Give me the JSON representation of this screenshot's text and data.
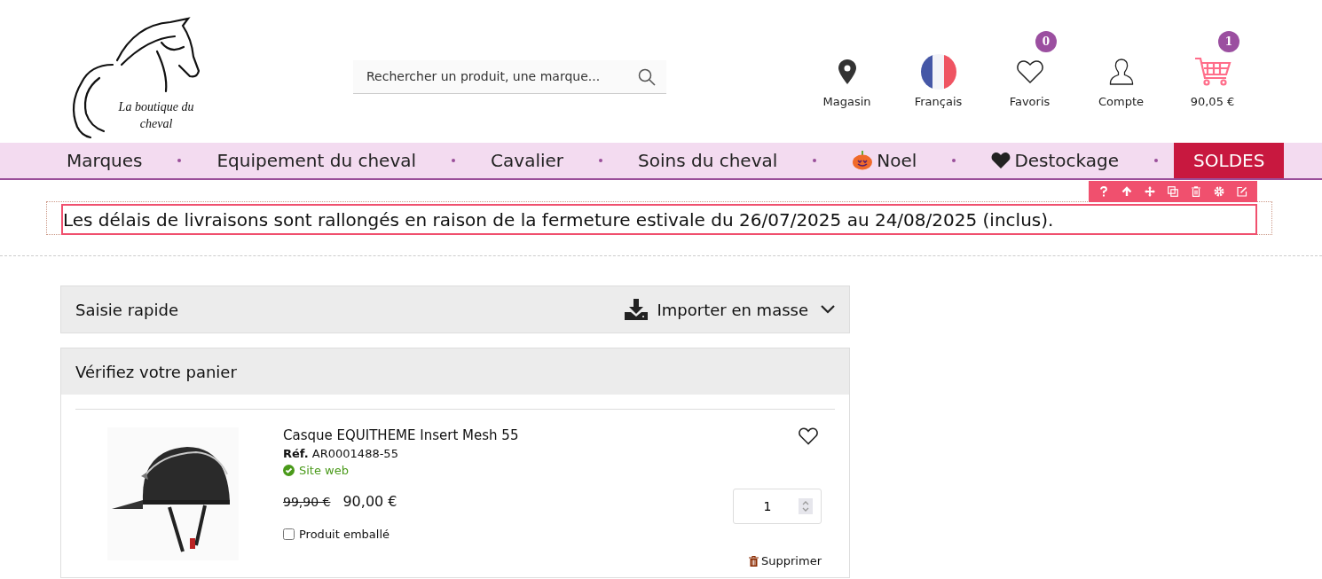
{
  "logo": {
    "text": "La boutique du cheval"
  },
  "search": {
    "placeholder": "Rechercher un produit, une marque..."
  },
  "header_links": [
    {
      "kind": "store",
      "label": "Magasin"
    },
    {
      "kind": "language",
      "label": "Français"
    },
    {
      "kind": "favorites",
      "label": "Favoris",
      "badge": "0"
    },
    {
      "kind": "account",
      "label": "Compte"
    },
    {
      "kind": "cart",
      "label": "90,05 €",
      "badge": "1"
    }
  ],
  "nav": [
    {
      "label": "Marques",
      "kind": "plain",
      "selected": false
    },
    {
      "label": "Equipement du cheval",
      "kind": "plain",
      "selected": false
    },
    {
      "label": "Cavalier",
      "kind": "plain",
      "selected": false
    },
    {
      "label": "Soins du cheval",
      "kind": "plain",
      "selected": false
    },
    {
      "label": "Noel",
      "kind": "seasonal",
      "selected": false
    },
    {
      "label": "Destockage",
      "kind": "promo",
      "selected": false
    },
    {
      "label": "SOLDES",
      "kind": "sale",
      "selected": true
    }
  ],
  "editor_toolbar": [
    {
      "kind": "help"
    },
    {
      "kind": "up"
    },
    {
      "kind": "move"
    },
    {
      "kind": "copy"
    },
    {
      "kind": "delete"
    },
    {
      "kind": "settings"
    },
    {
      "kind": "edit"
    }
  ],
  "notice": "Les délais de livraisons sont rallongés en raison de la fermeture estivale du 26/07/2025 au 24/08/2025 (inclus).",
  "quick_entry": {
    "title": "Saisie rapide",
    "action": "Importer en masse",
    "expanded": false
  },
  "cart": {
    "title": "Vérifiez votre panier",
    "items": [
      {
        "name": "Casque EQUITHEME Insert Mesh 55",
        "ref": "**Réf.** AR0001488-55",
        "availability": "Site web",
        "old_price": "99,90 €",
        "price": "90,00 €",
        "quantity": "1",
        "wrapped_label": "Produit emballé",
        "wrapped": false,
        "favorite": false,
        "remove": "Supprimer"
      }
    ]
  }
}
